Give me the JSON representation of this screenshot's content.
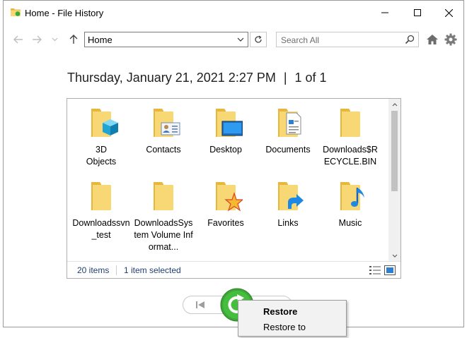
{
  "window": {
    "title": "Home - File History"
  },
  "toolbar": {
    "address": "Home",
    "search_placeholder": "Search All"
  },
  "snapshot": {
    "date": "Thursday, January 21, 2021 2:27 PM",
    "separator": "|",
    "page": "1 of 1"
  },
  "items": [
    {
      "label": "3D\nObjects",
      "icon": "folder-3d-objects-icon"
    },
    {
      "label": "Contacts",
      "icon": "folder-contacts-icon"
    },
    {
      "label": "Desktop",
      "icon": "folder-desktop-icon"
    },
    {
      "label": "Documents",
      "icon": "folder-documents-icon"
    },
    {
      "label": "Downloads$RECYCLE.BIN",
      "icon": "folder-icon"
    },
    {
      "label": "Downloadssvn_test",
      "icon": "folder-icon"
    },
    {
      "label": "DownloadsSystem Volume Informat...",
      "icon": "folder-icon"
    },
    {
      "label": "Favorites",
      "icon": "folder-favorites-icon"
    },
    {
      "label": "Links",
      "icon": "folder-links-icon"
    },
    {
      "label": "Music",
      "icon": "folder-music-icon"
    }
  ],
  "status": {
    "count": "20 items",
    "selected": "1 item selected"
  },
  "context_menu": {
    "restore": "Restore",
    "restore_to": "Restore to"
  },
  "colors": {
    "folder": "#f8d775",
    "folder_dark": "#e6b73c",
    "restore_green": "#3aa935",
    "accent_blue": "#1e88e5"
  }
}
